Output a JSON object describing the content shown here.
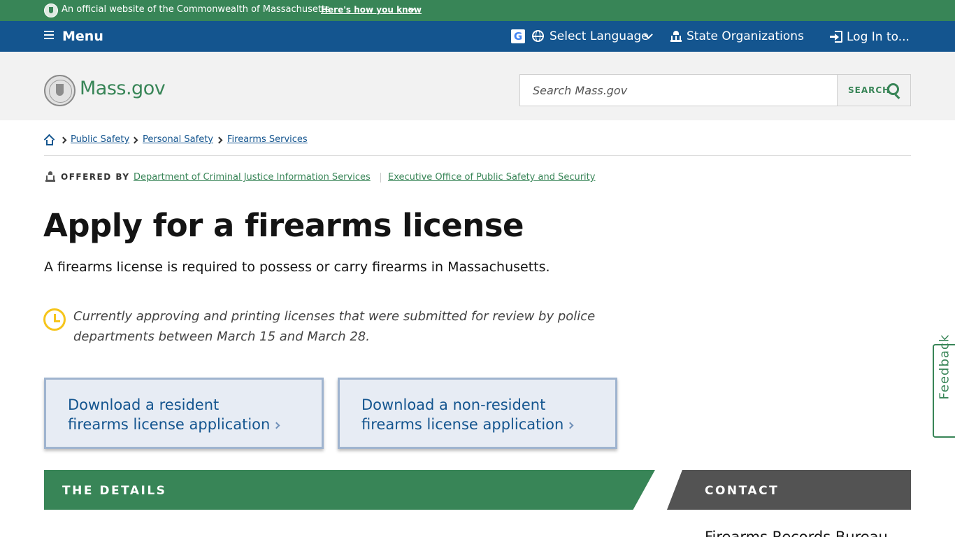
{
  "official_banner": {
    "text": "An official website of the Commonwealth of Massachusetts",
    "link": "Here's how you know"
  },
  "utility_nav": {
    "menu": "Menu",
    "language": "Select Language",
    "state_orgs": "State Organizations",
    "login": "Log In to..."
  },
  "header": {
    "logo_text": "Mass.gov",
    "search_placeholder": "Search Mass.gov",
    "search_button": "SEARCH"
  },
  "breadcrumb": {
    "items": [
      "Public Safety",
      "Personal Safety",
      "Firearms Services"
    ]
  },
  "offered_by": {
    "label": "OFFERED BY",
    "orgs": [
      "Department of Criminal Justice Information Services",
      "Executive Office of Public Safety and Security"
    ]
  },
  "page": {
    "title": "Apply for a firearms license",
    "subtitle": "A firearms license is required to possess or carry firearms in Massachusetts.",
    "notice": "Currently approving and printing licenses that were submitted for review by police departments between March 15 and March 28."
  },
  "downloads": [
    {
      "line1": "Download a resident",
      "line2": "firearms license application"
    },
    {
      "line1": "Download a non-resident",
      "line2": "firearms license application"
    }
  ],
  "sections": {
    "details": "THE DETAILS",
    "contact": "CONTACT",
    "contact_org": "Firearms Records Bureau"
  },
  "feedback": "Feedback",
  "colors": {
    "green": "#388557",
    "blue": "#14558f",
    "notice_icon": "#f6c51b"
  }
}
